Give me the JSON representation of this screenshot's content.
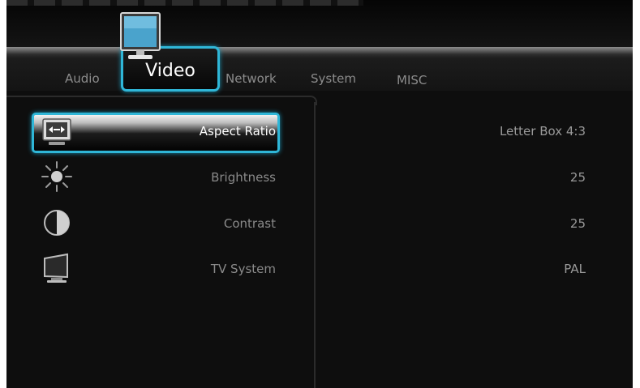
{
  "tabs": [
    {
      "label": "Audio"
    },
    {
      "label": "Video"
    },
    {
      "label": "Network"
    },
    {
      "label": "System"
    },
    {
      "label": "MISC"
    }
  ],
  "active_tab": "Video",
  "settings": [
    {
      "label": "Aspect Ratio",
      "value": "Letter Box 4:3",
      "icon": "aspect-ratio-icon"
    },
    {
      "label": "Brightness",
      "value": "25",
      "icon": "brightness-icon"
    },
    {
      "label": "Contrast",
      "value": "25",
      "icon": "contrast-icon"
    },
    {
      "label": "TV System",
      "value": "PAL",
      "icon": "tv-system-icon"
    }
  ],
  "colors": {
    "accent": "#2fb6d7",
    "background": "#0e0e0e"
  }
}
